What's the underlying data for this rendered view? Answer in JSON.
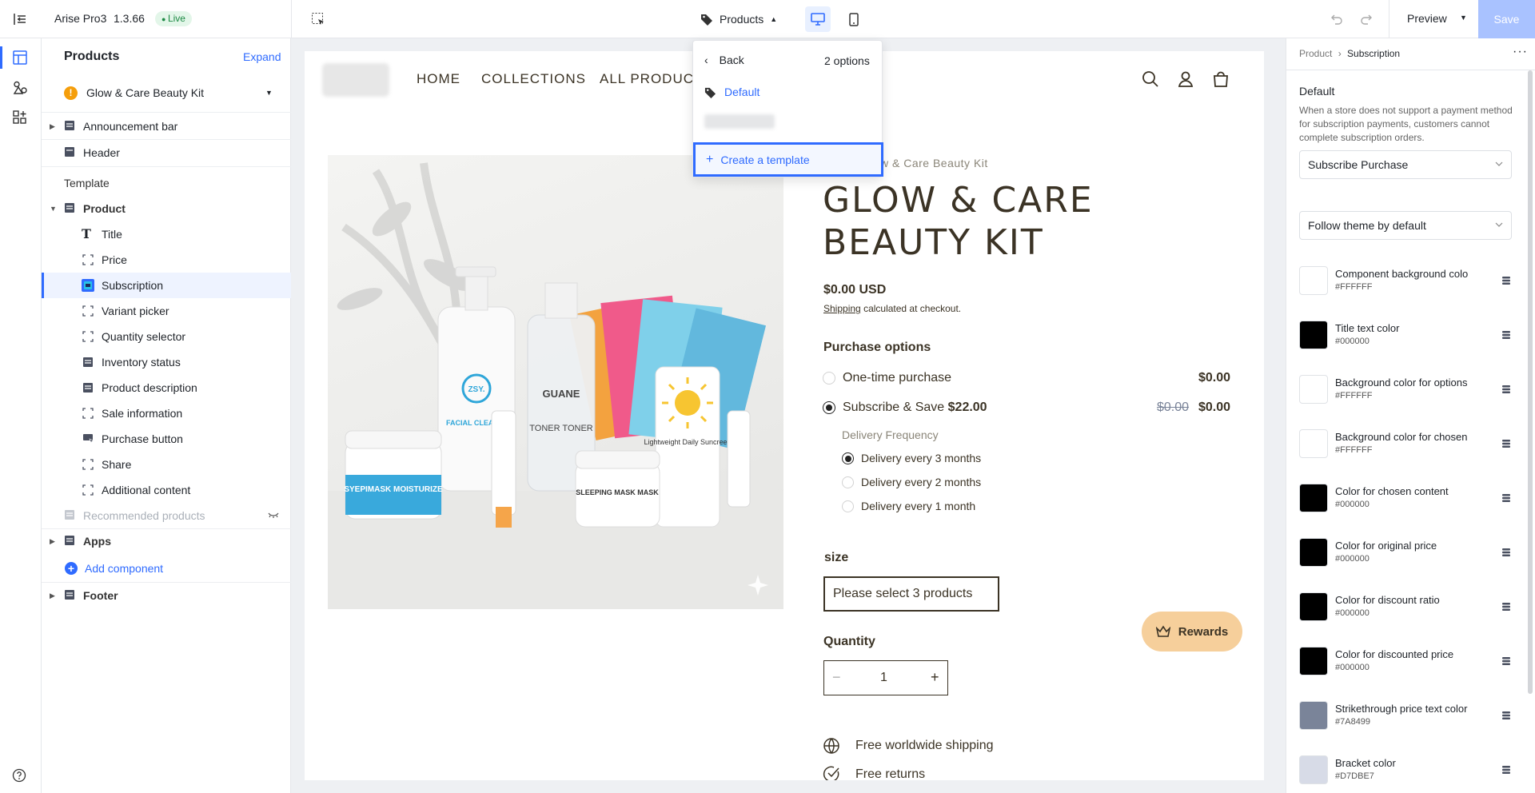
{
  "app": {
    "name": "Arise Pro3",
    "version": "1.3.66",
    "live_badge": "Live",
    "template_picker_label": "Products",
    "preview_label": "Preview",
    "save_label": "Save"
  },
  "template_dropdown": {
    "back_label": "Back",
    "options_count": "2 options",
    "default_label": "Default",
    "create_label": "Create a template"
  },
  "left_panel": {
    "title": "Products",
    "expand_label": "Expand",
    "selected_product": "Glow & Care Beauty Kit",
    "announcement_bar": "Announcement bar",
    "header": "Header",
    "template_section": "Template",
    "product": "Product",
    "product_children": [
      {
        "label": "Title"
      },
      {
        "label": "Price"
      },
      {
        "label": "Subscription"
      },
      {
        "label": "Variant picker"
      },
      {
        "label": "Quantity selector"
      },
      {
        "label": "Inventory status"
      },
      {
        "label": "Product description"
      },
      {
        "label": "Sale information"
      },
      {
        "label": "Purchase button"
      },
      {
        "label": "Share"
      },
      {
        "label": "Additional content"
      }
    ],
    "recommended_products": "Recommended products",
    "apps": "Apps",
    "add_component": "Add component",
    "footer": "Footer"
  },
  "store": {
    "nav": [
      "HOME",
      "COLLECTIONS",
      "ALL PRODUCT"
    ],
    "breadcrumb_fragment": "w & Care Beauty Kit",
    "product_title": "GLOW & CARE BEAUTY KIT",
    "price": "$0.00 USD",
    "shipping_link": "Shipping",
    "shipping_note": "calculated at checkout.",
    "purchase_options_label": "Purchase options",
    "one_time_label": "One-time purchase",
    "one_time_price": "$0.00",
    "subscribe_label": "Subscribe & Save",
    "subscribe_save_amount": "$22.00",
    "subscribe_original_price": "$0.00",
    "subscribe_price": "$0.00",
    "delivery_frequency_label": "Delivery Frequency",
    "delivery_options": [
      {
        "label": "Delivery every 3 months",
        "selected": true
      },
      {
        "label": "Delivery every 2 months",
        "selected": false
      },
      {
        "label": "Delivery every 1 month",
        "selected": false
      }
    ],
    "size_label": "size",
    "size_value": "Please select 3 products",
    "quantity_label": "Quantity",
    "quantity_value": "1",
    "rewards_label": "Rewards",
    "perks": [
      "Free worldwide shipping",
      "Free returns"
    ],
    "product_image_texts": {
      "bottle_brand": "ZSY.",
      "facial_cleanser": "FACIAL CLEANSER",
      "toner_brand": "GUANE",
      "toner": "TONER TONER",
      "jar_left": "SYEPIMASK MOISTURIZE",
      "jar_middle": "SLEEPING MASK MASK",
      "sunscreen": "Lightweight Daily Suncreen"
    }
  },
  "right_panel": {
    "breadcrumb_parent": "Product",
    "breadcrumb_current": "Subscription",
    "default_label": "Default",
    "help_text": "When a store does not support a payment method for subscription payments, customers cannot complete subscription orders.",
    "select_1": "Subscribe Purchase",
    "select_2": "Follow theme by default",
    "colors": [
      {
        "name": "Component background colo",
        "hex": "#FFFFFF",
        "color": "#FFFFFF"
      },
      {
        "name": "Title text color",
        "hex": "#000000",
        "color": "#000000"
      },
      {
        "name": "Background color for options",
        "hex": "#FFFFFF",
        "color": "#FFFFFF"
      },
      {
        "name": "Background color for chosen",
        "hex": "#FFFFFF",
        "color": "#FFFFFF"
      },
      {
        "name": "Color for chosen content",
        "hex": "#000000",
        "color": "#000000"
      },
      {
        "name": "Color for original price",
        "hex": "#000000",
        "color": "#000000"
      },
      {
        "name": "Color for discount ratio",
        "hex": "#000000",
        "color": "#000000"
      },
      {
        "name": "Color for discounted price",
        "hex": "#000000",
        "color": "#000000"
      },
      {
        "name": "Strikethrough price text color",
        "hex": "#7A8499",
        "color": "#7A8499"
      },
      {
        "name": "Bracket color",
        "hex": "#D7DBE7",
        "color": "#D7DBE7"
      }
    ]
  },
  "theme": {
    "accent": "#2f6bff",
    "live_bg": "#e3f6e9",
    "live_fg": "#1d8a44",
    "warning": "#f59e0b",
    "rewards_bg": "#f6cf9b",
    "store_text": "#3b3325"
  }
}
